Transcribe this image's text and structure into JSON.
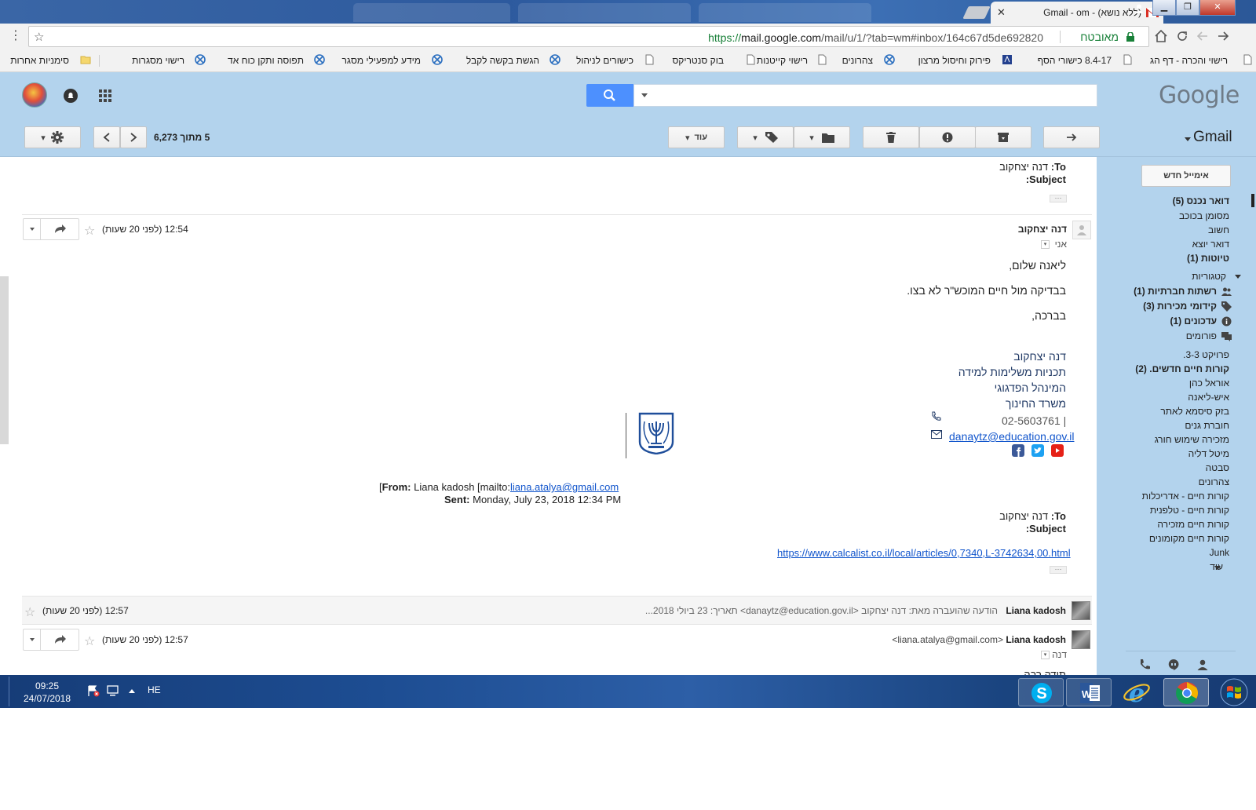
{
  "browser": {
    "tab_title": "(ללא נושא) - Gmail - om",
    "url_scheme": "https://",
    "url_host": "mail.google.com",
    "url_path": "/mail/u/1/?tab=wm#inbox/164c67d5de692820",
    "secure_label": "מאובטח",
    "bookmarks": [
      "רישוי והכרה - דף הג",
      "8.4-17 כישורי הסף",
      "פירוק וחיסול מרצון",
      "צהרונים",
      "רישוי קייטנות",
      "בוק סנטריקס",
      "כישורים לניהול",
      "הגשת בקשה לקבל",
      "מידע למפעילי מסגר",
      "תפוסה ותקן כוח אד",
      "רישוי מסגרות",
      "סימניות אחרות"
    ]
  },
  "gmail": {
    "logo": "Google",
    "app_label": "Gmail",
    "more_button": "עוד",
    "page_count": "5 מתוך 6,273",
    "compose": "אימייל חדש",
    "sidebar": {
      "items": [
        {
          "label": "דואר נכנס (5)",
          "bold": true
        },
        {
          "label": "מסומן בכוכב",
          "bold": false
        },
        {
          "label": "חשוב",
          "bold": false
        },
        {
          "label": "דואר יוצא",
          "bold": false
        },
        {
          "label": "טיוטות (1)",
          "bold": true
        }
      ],
      "categories_label": "קטגוריות",
      "categories": [
        {
          "label": "רשתות חברתיות (1)",
          "icon": "people-icon"
        },
        {
          "label": "קידומי מכירות (3)",
          "icon": "tag-icon"
        },
        {
          "label": "עדכונים (1)",
          "icon": "info-icon"
        },
        {
          "label": "פורומים",
          "icon": "forum-icon"
        }
      ],
      "labels": [
        {
          "label": "פרויקט 3-3.",
          "bold": false
        },
        {
          "label": "קורות חיים חדשים. (2)",
          "bold": true
        },
        {
          "label": "אוראל כהן",
          "bold": false
        },
        {
          "label": "איש-ליאנה",
          "bold": false
        },
        {
          "label": "בזק סיסמא לאתר",
          "bold": false
        },
        {
          "label": "חוברת גנים",
          "bold": false
        },
        {
          "label": "מזכירה שימוש חורג",
          "bold": false
        },
        {
          "label": "מיטל דליה",
          "bold": false
        },
        {
          "label": "סבטה",
          "bold": false
        },
        {
          "label": "צהרונים",
          "bold": false
        },
        {
          "label": "קורות חיים - אדריכלות",
          "bold": false
        },
        {
          "label": "קורות חיים - טלפנית",
          "bold": false
        },
        {
          "label": "קורות חיים מזכירה",
          "bold": false
        },
        {
          "label": "קורות חיים מקומונים",
          "bold": false
        },
        {
          "label": "Junk",
          "bold": false
        },
        {
          "label": "עוד",
          "bold": false
        }
      ]
    }
  },
  "thread": {
    "top_quote": {
      "to_label": "To:",
      "to_value": "דנה יצחקוב",
      "subject_label": "Subject:"
    },
    "message1": {
      "sender": "דנה יצחקוב",
      "recipient": "אני",
      "time": "12:54 (לפני 20 שעות)",
      "greeting": "ליאנה שלום,",
      "body": "בבדיקה מול חיים המוכש\"ר לא בצו.",
      "closing": "בברכה,",
      "signature": [
        "דנה יצחקוב",
        "תכניות משלימות למידה",
        "המינהל הפדגוגי",
        "משרד החינוך"
      ],
      "phone": "02-5603761 |",
      "email": "danaytz@education.gov.il",
      "from_label": "From:",
      "from_value": "Liana kadosh [mailto:",
      "from_email": "liana.atalya@gmail.com",
      "from_close": "]",
      "sent_label": "Sent:",
      "sent_value": "Monday, July 23, 2018 12:34 PM",
      "to_label": "To:",
      "to_value": "דנה יצחקוב",
      "subject_label": "Subject:",
      "link": "https://www.calcalist.co.il/local/articles/0,7340,L-3742634,00.html"
    },
    "message2": {
      "sender": "Liana kadosh",
      "snippet": "הודעה שהועברה מאת: דנה יצחקוב <danaytz@education.gov.il> תאריך: 23 ביולי 2018...",
      "time": "12:57 (לפני 20 שעות)"
    },
    "message3": {
      "sender": "Liana kadosh",
      "sender_email": "<liana.atalya@gmail.com>",
      "recipient": "דנה",
      "time": "12:57 (לפני 20 שעות)",
      "body_partial": "תודה רבה"
    }
  },
  "taskbar": {
    "time": "09:25",
    "date": "24/07/2018",
    "language": "HE"
  },
  "colors": {
    "gmail_blue": "#b3d3ed",
    "search_blue": "#4d90fe",
    "taskbar": "#1d4d92"
  }
}
